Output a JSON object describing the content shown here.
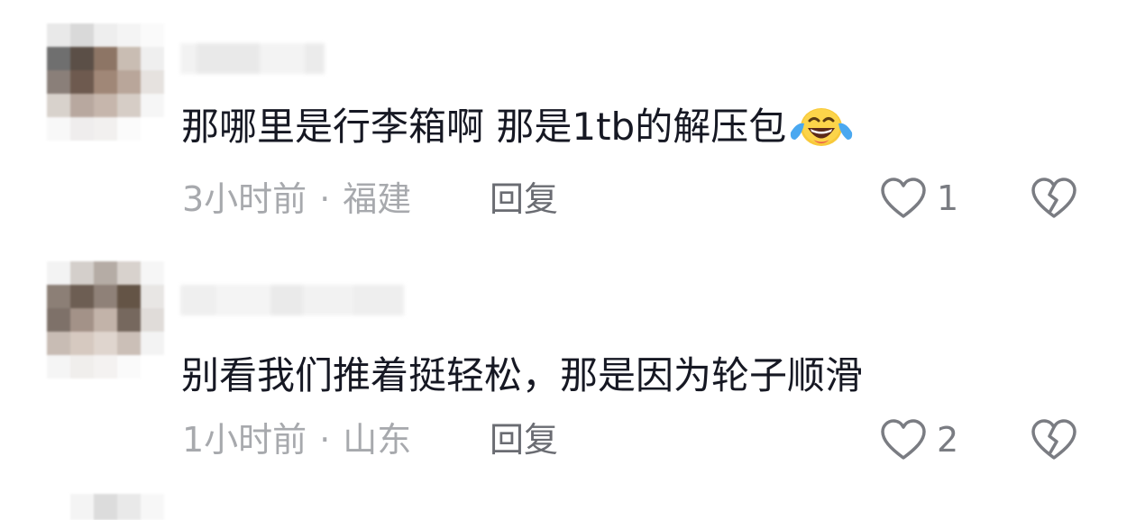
{
  "comments": [
    {
      "text": "那哪里是行李箱啊 那是1tb的解压包",
      "emoji": "laughing-tears-emoji",
      "time": "3小时前",
      "separator": "·",
      "location": "福建",
      "reply_label": "回复",
      "like_count": "1"
    },
    {
      "text": "别看我们推着挺轻松，那是因为轮子顺滑",
      "time": "1小时前",
      "separator": "·",
      "location": "山东",
      "reply_label": "回复",
      "like_count": "2"
    }
  ],
  "icons": {
    "like": "heart-outline-icon",
    "dislike": "broken-heart-icon"
  },
  "colors": {
    "text": "#161823",
    "meta": "#a7a9ad",
    "reply": "#6a6c72",
    "icon": "#7a7c82"
  }
}
